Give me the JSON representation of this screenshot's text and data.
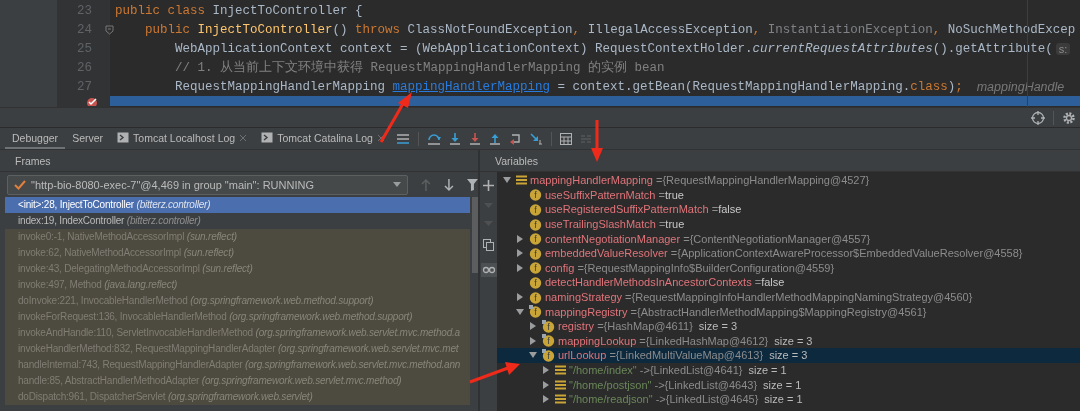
{
  "editor": {
    "lines": [
      {
        "number": "23",
        "fold": false,
        "segments": [
          {
            "kind": "keyword",
            "text": "public class "
          },
          {
            "kind": "plain",
            "text": "InjectToController {"
          }
        ]
      },
      {
        "number": "24",
        "fold": true,
        "segments": [
          {
            "kind": "keyword",
            "text": "    public "
          },
          {
            "kind": "method",
            "text": "InjectToController"
          },
          {
            "kind": "plain",
            "text": "() "
          },
          {
            "kind": "keyword",
            "text": "throws "
          },
          {
            "kind": "plain",
            "text": "ClassNotFoundException"
          },
          {
            "kind": "keyword",
            "text": ", "
          },
          {
            "kind": "plain",
            "text": "IllegalAccessException"
          },
          {
            "kind": "keyword",
            "text": ", "
          },
          {
            "kind": "muted",
            "text": "InstantiationException"
          },
          {
            "kind": "keyword",
            "text": ", "
          },
          {
            "kind": "plain",
            "text": "NoSuchMethodExcep"
          }
        ]
      },
      {
        "number": "25",
        "fold": false,
        "segments": [
          {
            "kind": "plain",
            "text": "        WebApplicationContext context = (WebApplicationContext) RequestContextHolder."
          },
          {
            "kind": "italic",
            "text": "currentRequestAttributes"
          },
          {
            "kind": "plain",
            "text": "().getAttribute("
          },
          {
            "kind": "hint-box",
            "text": "s:"
          }
        ]
      },
      {
        "number": "26",
        "fold": false,
        "segments": [
          {
            "kind": "comment",
            "text": "        // 1. 从当前上下文环境中获得 RequestMappingHandlerMapping 的实例 bean"
          }
        ]
      },
      {
        "number": "27",
        "fold": false,
        "segments": [
          {
            "kind": "plain",
            "text": "        RequestMappingHandlerMapping "
          },
          {
            "kind": "link",
            "text": "mappingHandlerMapping"
          },
          {
            "kind": "plain",
            "text": " = context.getBean(RequestMappingHandlerMapping."
          },
          {
            "kind": "keyword",
            "text": "class"
          },
          {
            "kind": "plain",
            "text": ")"
          },
          {
            "kind": "keyword",
            "text": ";"
          },
          {
            "kind": "hint",
            "text": "mappingHandle"
          }
        ]
      }
    ],
    "current_line": {
      "breakpoint": true
    }
  },
  "tabs": [
    {
      "label": "Debugger",
      "selected": true,
      "kind": "plain"
    },
    {
      "label": "Server",
      "selected": false,
      "kind": "plain"
    },
    {
      "label": "Tomcat Localhost Log",
      "selected": false,
      "kind": "log"
    },
    {
      "label": "Tomcat Catalina Log",
      "selected": false,
      "kind": "log"
    }
  ],
  "frames": {
    "title": "Frames",
    "thread": "\"http-bio-8080-exec-7\"@4,469 in group \"main\": RUNNING",
    "items": [
      {
        "method": "<init>:28, InjectToController",
        "package": "(bitterz.controller)",
        "library": false,
        "selected": true
      },
      {
        "method": "index:19, IndexController",
        "package": "(bitterz.controller)",
        "library": false,
        "selected": false
      },
      {
        "method": "invoke0:-1, NativeMethodAccessorImpl",
        "package": "(sun.reflect)",
        "library": true,
        "selected": false
      },
      {
        "method": "invoke:62, NativeMethodAccessorImpl",
        "package": "(sun.reflect)",
        "library": true,
        "selected": false
      },
      {
        "method": "invoke:43, DelegatingMethodAccessorImpl",
        "package": "(sun.reflect)",
        "library": true,
        "selected": false
      },
      {
        "method": "invoke:497, Method",
        "package": "(java.lang.reflect)",
        "library": true,
        "selected": false
      },
      {
        "method": "doInvoke:221, InvocableHandlerMethod",
        "package": "(org.springframework.web.method.support)",
        "library": true,
        "selected": false
      },
      {
        "method": "invokeForRequest:136, InvocableHandlerMethod",
        "package": "(org.springframework.web.method.support)",
        "library": true,
        "selected": false
      },
      {
        "method": "invokeAndHandle:110, ServletInvocableHandlerMethod",
        "package": "(org.springframework.web.servlet.mvc.method.a",
        "library": true,
        "selected": false
      },
      {
        "method": "invokeHandlerMethod:832, RequestMappingHandlerAdapter",
        "package": "(org.springframework.web.servlet.mvc.met",
        "library": true,
        "selected": false
      },
      {
        "method": "handleInternal:743, RequestMappingHandlerAdapter",
        "package": "(org.springframework.web.servlet.mvc.method.ann",
        "library": true,
        "selected": false
      },
      {
        "method": "handle:85, AbstractHandlerMethodAdapter",
        "package": "(org.springframework.web.servlet.mvc.method)",
        "library": true,
        "selected": false
      },
      {
        "method": "doDispatch:961, DispatcherServlet",
        "package": "(org.springframework.web.servlet)",
        "library": true,
        "selected": false
      }
    ]
  },
  "variables": {
    "title": "Variables",
    "items": [
      {
        "kind": "watch",
        "name": "mappingHandlerMapping",
        "separator": "=",
        "value": "{RequestMappingHandlerMapping@4527}",
        "expanded": true,
        "selected": false,
        "children": [
          {
            "kind": "field",
            "icon": "f",
            "name": "useSuffixPatternMatch",
            "separator": "=",
            "value": "true",
            "primitive": true,
            "selected": false
          },
          {
            "kind": "field",
            "icon": "f",
            "name": "useRegisteredSuffixPatternMatch",
            "separator": "=",
            "value": "false",
            "primitive": true,
            "selected": false
          },
          {
            "kind": "field",
            "icon": "f",
            "name": "useTrailingSlashMatch",
            "separator": "=",
            "value": "true",
            "primitive": true,
            "selected": false
          },
          {
            "kind": "field",
            "icon": "f",
            "name": "contentNegotiationManager",
            "separator": "=",
            "value": "{ContentNegotiationManager@4557}",
            "expanded": false,
            "selected": false
          },
          {
            "kind": "field",
            "icon": "f",
            "name": "embeddedValueResolver",
            "separator": "=",
            "value": "{ApplicationContextAwareProcessor$EmbeddedValueResolver@4558}",
            "expanded": false,
            "selected": false
          },
          {
            "kind": "field",
            "icon": "f",
            "name": "config",
            "separator": "=",
            "value": "{RequestMappingInfo$BuilderConfiguration@4559}",
            "expanded": false,
            "selected": false
          },
          {
            "kind": "field",
            "icon": "f",
            "name": "detectHandlerMethodsInAncestorContexts",
            "separator": "=",
            "value": "false",
            "primitive": true,
            "selected": false
          },
          {
            "kind": "field",
            "icon": "f",
            "name": "namingStrategy",
            "separator": "=",
            "value": "{RequestMappingInfoHandlerMethodMappingNamingStrategy@4560}",
            "expanded": false,
            "selected": false
          },
          {
            "kind": "final-field",
            "icon": "f",
            "name": "mappingRegistry",
            "separator": "=",
            "value": "{AbstractHandlerMethodMapping$MappingRegistry@4561}",
            "expanded": true,
            "selected": false,
            "children": [
              {
                "kind": "final-field",
                "icon": "f",
                "name": "registry",
                "separator": "=",
                "value": "{HashMap@4611}",
                "size": "size = 3",
                "expanded": false,
                "selected": false
              },
              {
                "kind": "final-field",
                "icon": "f",
                "name": "mappingLookup",
                "separator": "=",
                "value": "{LinkedHashMap@4612}",
                "size": "size = 3",
                "expanded": false,
                "selected": false
              },
              {
                "kind": "final-field",
                "icon": "f",
                "name": "urlLookup",
                "separator": "=",
                "value": "{LinkedMultiValueMap@4613}",
                "size": "size = 3",
                "expanded": true,
                "selected": true,
                "children": [
                  {
                    "kind": "entry",
                    "key": "\"/home/index\"",
                    "separator": "->",
                    "value": "{LinkedList@4641}",
                    "size": "size = 1",
                    "expanded": false,
                    "selected": false
                  },
                  {
                    "kind": "entry",
                    "key": "\"/home/postjson\"",
                    "separator": "->",
                    "value": "{LinkedList@4643}",
                    "size": "size = 1",
                    "expanded": false,
                    "selected": false
                  },
                  {
                    "kind": "entry",
                    "key": "\"/home/readjson\"",
                    "separator": "->",
                    "value": "{LinkedList@4645}",
                    "size": "size = 1",
                    "expanded": false,
                    "selected": false
                  }
                ]
              }
            ]
          }
        ]
      }
    ]
  }
}
